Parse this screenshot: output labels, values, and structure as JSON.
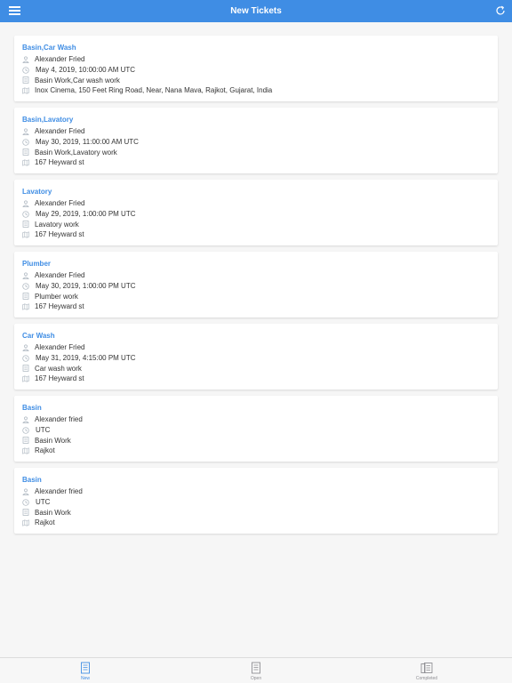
{
  "header": {
    "title": "New Tickets",
    "menu_icon": "hamburger-menu-icon",
    "refresh_icon": "refresh-icon",
    "bg_color": "#3f8de4"
  },
  "tickets": [
    {
      "title": "Basin,Car Wash",
      "assignee": "Alexander Fried",
      "datetime": "May 4, 2019, 10:00:00 AM UTC",
      "work": "Basin Work,Car wash work",
      "address": "Inox Cinema, 150 Feet Ring Road, Near, Nana Mava, Rajkot, Gujarat, India"
    },
    {
      "title": "Basin,Lavatory",
      "assignee": "Alexander Fried",
      "datetime": "May 30, 2019, 11:00:00 AM UTC",
      "work": "Basin Work,Lavatory work",
      "address": "167 Heyward st"
    },
    {
      "title": "Lavatory",
      "assignee": "Alexander Fried",
      "datetime": "May 29, 2019, 1:00:00 PM UTC",
      "work": "Lavatory work",
      "address": "167 Heyward st"
    },
    {
      "title": "Plumber",
      "assignee": "Alexander Fried",
      "datetime": "May 30, 2019, 1:00:00 PM UTC",
      "work": "Plumber work",
      "address": "167 Heyward st"
    },
    {
      "title": "Car Wash",
      "assignee": "Alexander Fried",
      "datetime": "May 31, 2019, 4:15:00 PM UTC",
      "work": "Car wash work",
      "address": "167 Heyward st"
    },
    {
      "title": "Basin",
      "assignee": "Alexander fried",
      "datetime": "UTC",
      "work": "Basin Work",
      "address": "Rajkot"
    },
    {
      "title": "Basin",
      "assignee": "Alexander fried",
      "datetime": "UTC",
      "work": "Basin Work",
      "address": "Rajkot"
    }
  ],
  "row_icons": [
    "person-icon",
    "clock-icon",
    "document-icon",
    "map-icon"
  ],
  "tabbar": {
    "tabs": [
      {
        "label": "New",
        "icon": "new-tickets-icon",
        "active": true
      },
      {
        "label": "Open",
        "icon": "open-tickets-icon",
        "active": false
      },
      {
        "label": "Completed",
        "icon": "completed-tickets-icon",
        "active": false
      }
    ]
  },
  "colors": {
    "accent": "#3f8de4",
    "icon_gray": "#a9b3bd",
    "tab_inactive": "#8e8e93"
  }
}
